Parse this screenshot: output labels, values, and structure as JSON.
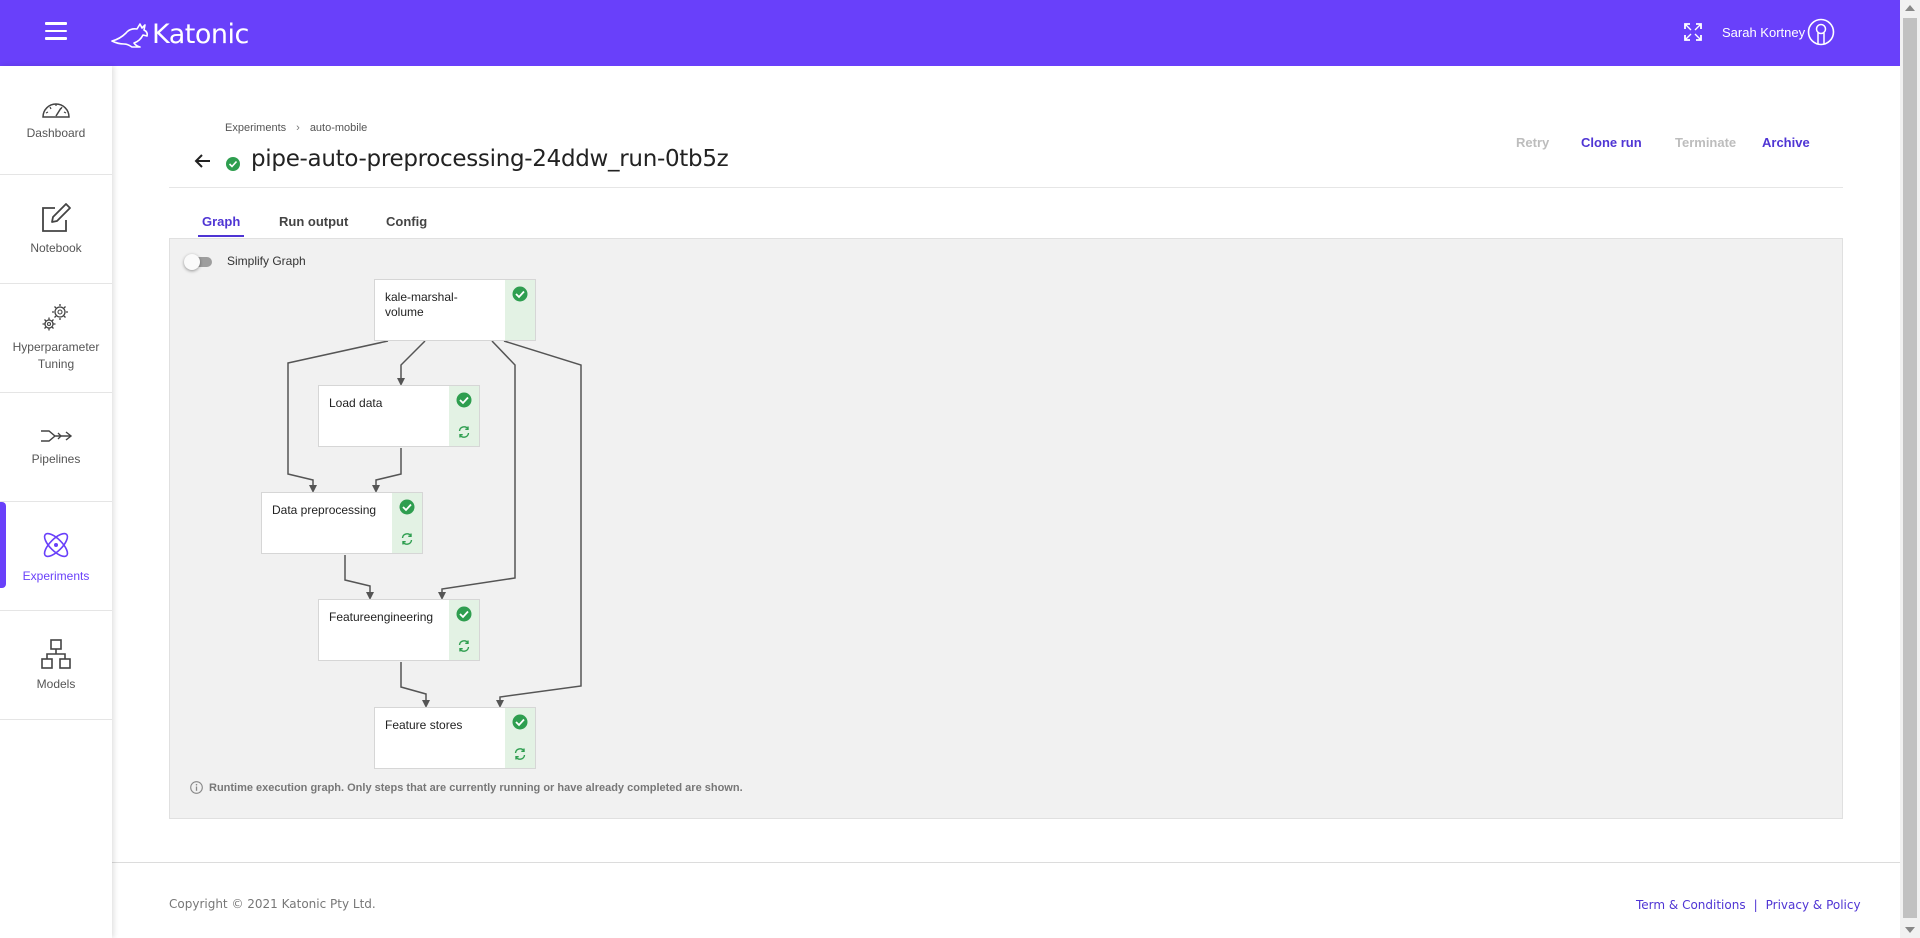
{
  "header": {
    "brand": "Katonic",
    "user_name": "Sarah Kortney"
  },
  "sidebar": {
    "items": [
      {
        "label": "Dashboard",
        "icon": "gauge-icon"
      },
      {
        "label": "Notebook",
        "icon": "edit-icon"
      },
      {
        "label": "Hyperparameter Tuning",
        "icon": "gears-icon"
      },
      {
        "label": "Pipelines",
        "icon": "pipeline-icon"
      },
      {
        "label": "Experiments",
        "icon": "atom-icon",
        "active": true
      },
      {
        "label": "Models",
        "icon": "hierarchy-icon"
      }
    ]
  },
  "breadcrumb": [
    "Experiments",
    "auto-mobile"
  ],
  "run": {
    "title": "pipe-auto-preprocessing-24ddw_run-0tb5z",
    "status": "success"
  },
  "actions": {
    "retry": "Retry",
    "clone": "Clone run",
    "terminate": "Terminate",
    "archive": "Archive"
  },
  "tabs": [
    {
      "label": "Graph",
      "active": true
    },
    {
      "label": "Run output"
    },
    {
      "label": "Config"
    }
  ],
  "graph": {
    "simplify_label": "Simplify Graph",
    "simplify_on": false,
    "nodes": [
      {
        "label": "kale-marshal-volume",
        "status": "success"
      },
      {
        "label": "Load data",
        "status": "success"
      },
      {
        "label": "Data preprocessing",
        "status": "success"
      },
      {
        "label": "Featureengineering",
        "status": "success"
      },
      {
        "label": "Feature stores",
        "status": "success"
      }
    ],
    "note": "Runtime execution graph. Only steps that are currently running or have already completed are shown."
  },
  "footer": {
    "copyright": "Copyright © 2021 Katonic Pty Ltd.",
    "terms": "Term & Conditions",
    "separator": "|",
    "privacy": "Privacy & Policy"
  },
  "colors": {
    "brand": "#6940fa",
    "link": "#4f35d4",
    "success": "#2e9e4f",
    "node_side": "#e3f2e4"
  }
}
